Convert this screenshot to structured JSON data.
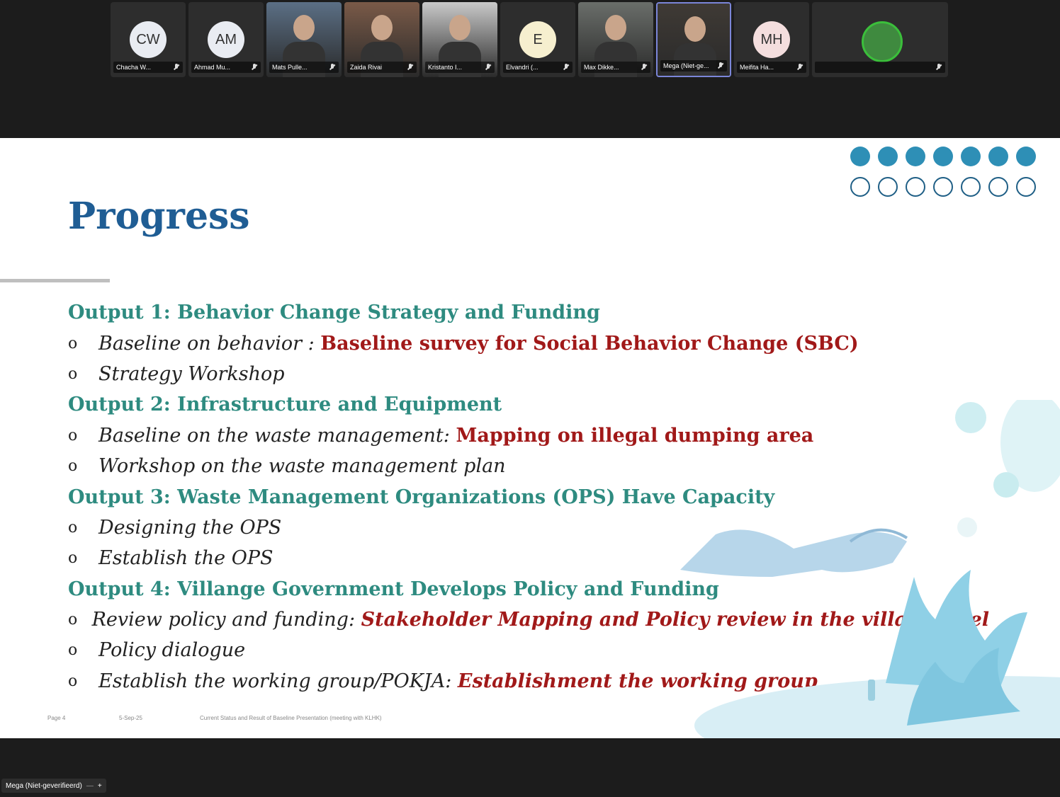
{
  "participants": [
    {
      "initials": "CW",
      "name": "Chacha W...",
      "avatar_color": "#e9ecf2",
      "type": "initials"
    },
    {
      "initials": "AM",
      "name": "Ahmad Mu...",
      "avatar_color": "#e9ecf2",
      "type": "initials"
    },
    {
      "initials": "",
      "name": "Mats Pulle...",
      "type": "video"
    },
    {
      "initials": "",
      "name": "Zaida Rivai",
      "type": "video"
    },
    {
      "initials": "",
      "name": "Kristanto I...",
      "type": "video"
    },
    {
      "initials": "E",
      "name": "Elvandri (...",
      "avatar_color": "#f6efcf",
      "type": "initials"
    },
    {
      "initials": "",
      "name": "Max Dikke...",
      "type": "video"
    },
    {
      "initials": "",
      "name": "Mega (Niet-ge...",
      "type": "video",
      "speaking": true
    },
    {
      "initials": "MH",
      "name": "Meifita Ha...",
      "avatar_color": "#f4dede",
      "type": "initials"
    },
    {
      "initials": "",
      "name": "",
      "type": "avatar-photo"
    }
  ],
  "slide": {
    "title": "Progress",
    "outputs": [
      {
        "heading": "Output 1: Behavior Change Strategy and Funding",
        "items": [
          {
            "text": "Baseline on behavior : ",
            "highlight": "Baseline survey for Social Behavior Change (SBC)",
            "highlight_style": "normal"
          },
          {
            "text": "Strategy Workshop",
            "highlight": ""
          }
        ]
      },
      {
        "heading": "Output 2: Infrastructure and Equipment",
        "items": [
          {
            "text": "Baseline on the waste management: ",
            "highlight": "Mapping on illegal dumping area",
            "highlight_style": "normal"
          },
          {
            "text": "Workshop on the waste management plan",
            "highlight": ""
          }
        ]
      },
      {
        "heading": "Output 3: Waste Management Organizations (OPS) Have Capacity",
        "items": [
          {
            "text": "Designing the OPS",
            "highlight": ""
          },
          {
            "text": "Establish the OPS",
            "highlight": ""
          }
        ]
      },
      {
        "heading": "Output 4: Villange Government Develops Policy and Funding",
        "items": [
          {
            "text": "Review policy and funding: ",
            "highlight": "Stakeholder Mapping and Policy review in the village level",
            "highlight_style": "italic"
          },
          {
            "text": "Policy dialogue",
            "highlight": ""
          },
          {
            "text": "Establish the working group/POKJA: ",
            "highlight": "Establishment the working group",
            "highlight_style": "italic"
          }
        ]
      }
    ],
    "bullet_glyph": "o",
    "footer": {
      "page": "Page 4",
      "date": "5-Sep-25",
      "caption": "Current Status and Result of Baseline Presentation (meeting with KLHK)"
    }
  },
  "presenter": {
    "label": "Mega (Niet-geverifieerd)",
    "sep": "—",
    "plus": "+"
  },
  "colors": {
    "title": "#1f5d94",
    "output_heading": "#2e8b80",
    "highlight": "#a11919",
    "dot_fill": "#2e8fb6"
  }
}
